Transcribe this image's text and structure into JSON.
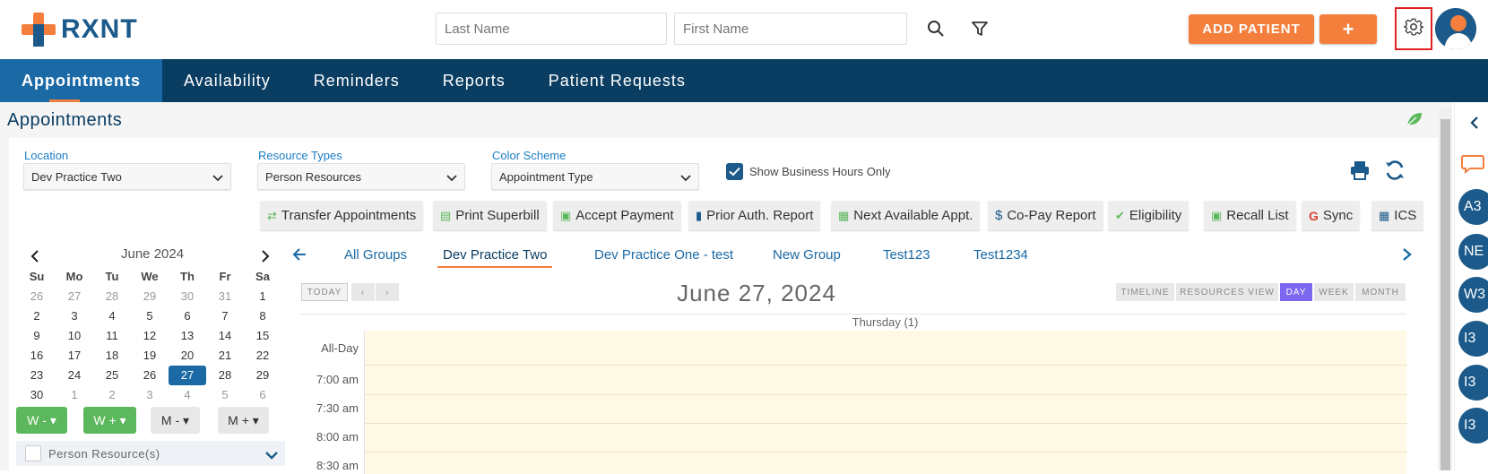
{
  "brand": {
    "logo_text": "RXNT",
    "accent": "#f47f3c",
    "primary": "#1b5a8a",
    "nav_bg": "#0a3d62"
  },
  "header": {
    "last_name_placeholder": "Last Name",
    "first_name_placeholder": "First Name",
    "add_patient_label": "ADD PATIENT",
    "plus_label": "+",
    "icons": [
      "search-icon",
      "filter-icon",
      "gear-icon",
      "user-avatar"
    ]
  },
  "nav": {
    "items": [
      {
        "label": "Appointments",
        "active": true
      },
      {
        "label": "Availability"
      },
      {
        "label": "Reminders"
      },
      {
        "label": "Reports"
      },
      {
        "label": "Patient Requests"
      }
    ]
  },
  "page": {
    "title": "Appointments"
  },
  "filters": {
    "location": {
      "label": "Location",
      "value": "Dev Practice Two"
    },
    "resource_types": {
      "label": "Resource Types",
      "value": "Person Resources"
    },
    "color_scheme": {
      "label": "Color Scheme",
      "value": "Appointment Type"
    },
    "business_hours": {
      "label": "Show Business Hours Only",
      "checked": true
    }
  },
  "actions": [
    "Transfer Appointments",
    "Print Superbill",
    "Accept Payment",
    "Prior Auth. Report",
    "Next Available Appt.",
    "Co-Pay Report",
    "Eligibility",
    "Recall List",
    "Sync",
    "ICS"
  ],
  "mini_calendar": {
    "month": "June 2024",
    "weekdays": [
      "Su",
      "Mo",
      "Tu",
      "We",
      "Th",
      "Fr",
      "Sa"
    ],
    "weeks": [
      [
        "26",
        "27",
        "28",
        "29",
        "30",
        "31",
        "1"
      ],
      [
        "2",
        "3",
        "4",
        "5",
        "6",
        "7",
        "8"
      ],
      [
        "9",
        "10",
        "11",
        "12",
        "13",
        "14",
        "15"
      ],
      [
        "16",
        "17",
        "18",
        "19",
        "20",
        "21",
        "22"
      ],
      [
        "23",
        "24",
        "25",
        "26",
        "27",
        "28",
        "29"
      ],
      [
        "30",
        "1",
        "2",
        "3",
        "4",
        "5",
        "6"
      ]
    ],
    "selected": "27"
  },
  "week_month_buttons": [
    "W -",
    "W +",
    "M -",
    "M +"
  ],
  "resources_label": "Person Resource(s)",
  "groups": {
    "tabs": [
      "All Groups",
      "Dev Practice Two",
      "Dev Practice One - test",
      "New Group",
      "Test123",
      "Test1234"
    ],
    "active": "Dev Practice Two"
  },
  "schedule": {
    "today_label": "TODAY",
    "date_title": "June 27, 2024",
    "view_buttons": [
      "TIMELINE",
      "RESOURCES VIEW",
      "DAY",
      "WEEK",
      "MONTH"
    ],
    "active_view": "DAY",
    "column_header": "Thursday (1)",
    "all_day_label": "All-Day",
    "times": [
      "7:00 am",
      "7:30 am",
      "8:00 am",
      "8:30 am"
    ]
  },
  "rail": {
    "avatars": [
      "A3",
      "NE",
      "W3",
      "I3",
      "I3",
      "I3"
    ]
  }
}
